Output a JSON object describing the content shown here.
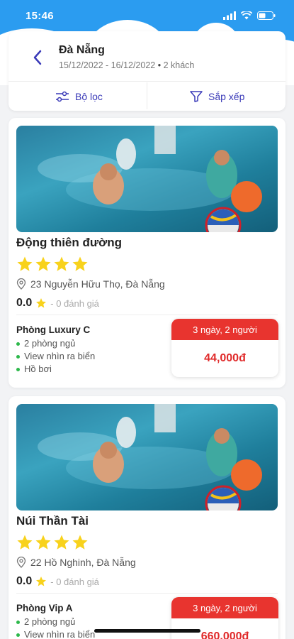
{
  "status_bar": {
    "time": "15:46"
  },
  "header": {
    "city": "Đà Nẵng",
    "dates": "15/12/2022 - 16/12/2022",
    "guests": "2 khách",
    "filter_label": "Bộ lọc",
    "sort_label": "Sắp xếp"
  },
  "hotels": [
    {
      "name": "Động thiên đường",
      "stars": 4,
      "address": "23 Nguyễn Hữu Thọ, Đà Nẵng",
      "rating": "0.0",
      "review_count": "- 0 đánh giá",
      "room_name": "Phòng Luxury C",
      "features": [
        "2 phòng ngủ",
        "View nhìn ra biển",
        "Hồ bơi"
      ],
      "price_header": "3 ngày, 2 người",
      "price": "44,000đ"
    },
    {
      "name": "Núi Thần Tài",
      "stars": 4,
      "address": "22 Hồ Nghinh, Đà Nẵng",
      "rating": "0.0",
      "review_count": "- 0 đánh giá",
      "room_name": "Phòng Vip A",
      "features": [
        "2 phòng ngủ",
        "View nhìn ra biển"
      ],
      "price_header": "3 ngày, 2 người",
      "price": "660,000đ"
    }
  ],
  "colors": {
    "accent": "#3a3ab8",
    "price_red": "#e8342f",
    "star": "#f8d21c",
    "bullet_green": "#2db84b",
    "sky": "#2b9cf0"
  }
}
